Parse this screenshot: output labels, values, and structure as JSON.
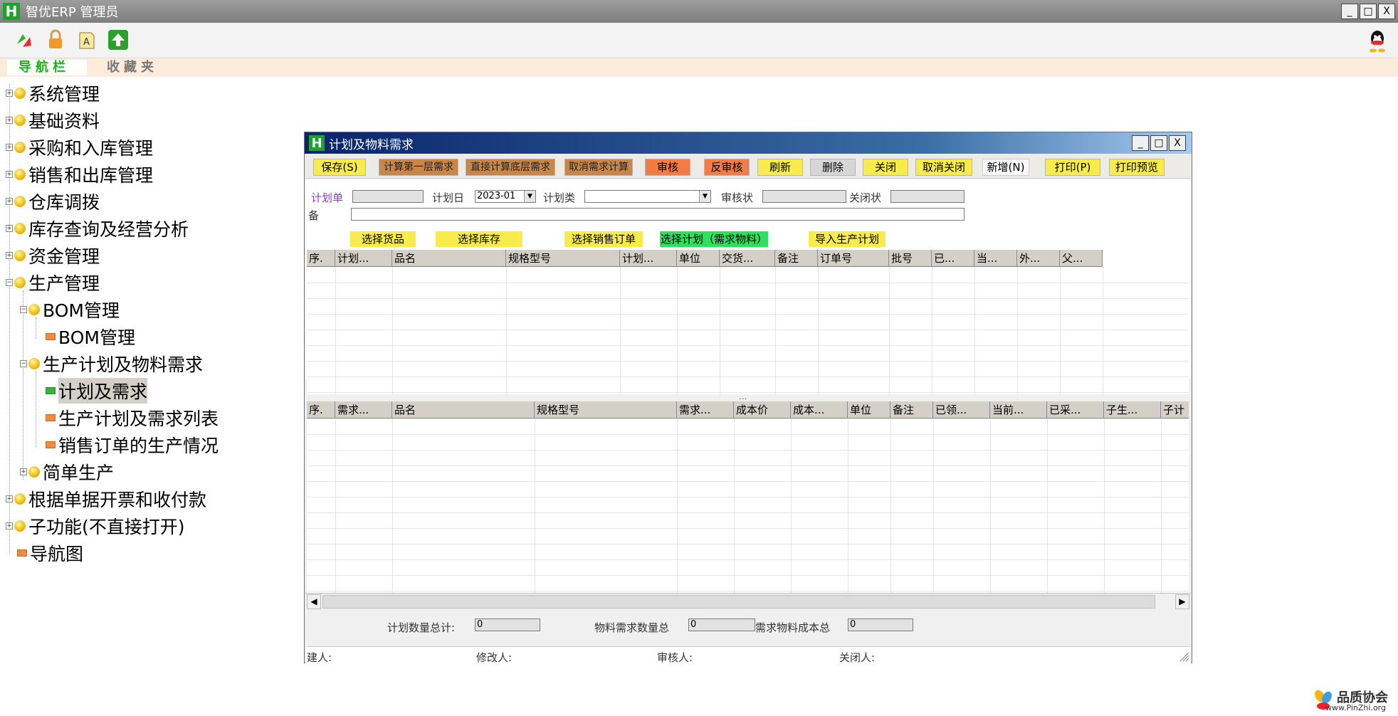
{
  "app": {
    "logo": "H",
    "title": "智优ERP 管理员"
  },
  "window_controls": {
    "minimize": "_",
    "maximize": "□",
    "close": "X"
  },
  "toolbar_icons": [
    "refresh-icon",
    "lock-icon",
    "font-icon",
    "upload-icon",
    "qq-icon"
  ],
  "nav_tabs": {
    "active": "导航栏",
    "inactive": "收藏夹"
  },
  "tree": {
    "items": [
      {
        "label": "系统管理"
      },
      {
        "label": "基础资料"
      },
      {
        "label": "采购和入库管理"
      },
      {
        "label": "销售和出库管理"
      },
      {
        "label": "仓库调拨"
      },
      {
        "label": "库存查询及经营分析"
      },
      {
        "label": "资金管理"
      },
      {
        "label": "生产管理"
      },
      {
        "label": "BOM管理"
      },
      {
        "label": "BOM管理"
      },
      {
        "label": "生产计划及物料需求"
      },
      {
        "label": "计划及需求"
      },
      {
        "label": "生产计划及需求列表"
      },
      {
        "label": "销售订单的生产情况"
      },
      {
        "label": "简单生产"
      },
      {
        "label": "根据单据开票和收付款"
      },
      {
        "label": "子功能(不直接打开)"
      },
      {
        "label": "导航图"
      }
    ]
  },
  "child_window": {
    "logo": "H",
    "title": "计划及物料需求",
    "buttons": [
      {
        "label": "保存(S)"
      },
      {
        "label": "计算第一层需求"
      },
      {
        "label": "直接计算底层需求"
      },
      {
        "label": "取消需求计算"
      },
      {
        "label": "审核"
      },
      {
        "label": "反审核"
      },
      {
        "label": "刷新"
      },
      {
        "label": "删除"
      },
      {
        "label": "关闭"
      },
      {
        "label": "取消关闭"
      },
      {
        "label": "新增(N)"
      },
      {
        "label": "打印(P)"
      },
      {
        "label": "打印预览"
      }
    ],
    "form": {
      "plan_no_label": "计划单",
      "plan_no_value": "",
      "plan_date_label": "计划日",
      "plan_date_value": "2023-01",
      "plan_type_label": "计划类",
      "plan_type_value": "",
      "audit_label": "审核状",
      "audit_value": "",
      "close_label": "关闭状",
      "close_value": "",
      "remark_label": "备",
      "remark_value": ""
    },
    "action_buttons": [
      {
        "label": "选择货品"
      },
      {
        "label": "选择库存"
      },
      {
        "label": "选择销售订单"
      },
      {
        "label": "选择计划（需求物料）"
      },
      {
        "label": "导入生产计划"
      }
    ],
    "top_grid": {
      "columns": [
        "序.",
        "计划...",
        "品名",
        "规格型号",
        "计划...",
        "单位",
        "交货...",
        "备注",
        "订单号",
        "批号",
        "已...",
        "当...",
        "外...",
        "父..."
      ],
      "rows": []
    },
    "splitter": "...",
    "bottom_grid": {
      "columns": [
        "序.",
        "需求...",
        "品名",
        "规格型号",
        "需求...",
        "成本价",
        "成本...",
        "单位",
        "备注",
        "已领...",
        "当前...",
        "已采...",
        "子生...",
        "子计"
      ],
      "rows": []
    },
    "scroll_left": "◀",
    "scroll_right": "▶",
    "totals": {
      "plan_qty_label": "计划数量总计:",
      "plan_qty_value": "0",
      "material_qty_label": "物料需求数量总",
      "material_qty_value": "0",
      "material_cost_label": "需求物料成本总",
      "material_cost_value": "0"
    },
    "status": {
      "creator_label": "建人:",
      "modifier_label": "修改人:",
      "auditor_label": "审核人:",
      "closer_label": "关闭人:"
    }
  },
  "brand": {
    "name": "品质协会",
    "url": "www.PinZhi.org"
  },
  "colors": {
    "active_tab": "#19b219",
    "yellow_button": "#f7ec4c",
    "orange_button": "#f27c45",
    "green_button": "#2ee05c",
    "brown_button": "#c9864a",
    "child_titlebar": "#0a246a"
  }
}
